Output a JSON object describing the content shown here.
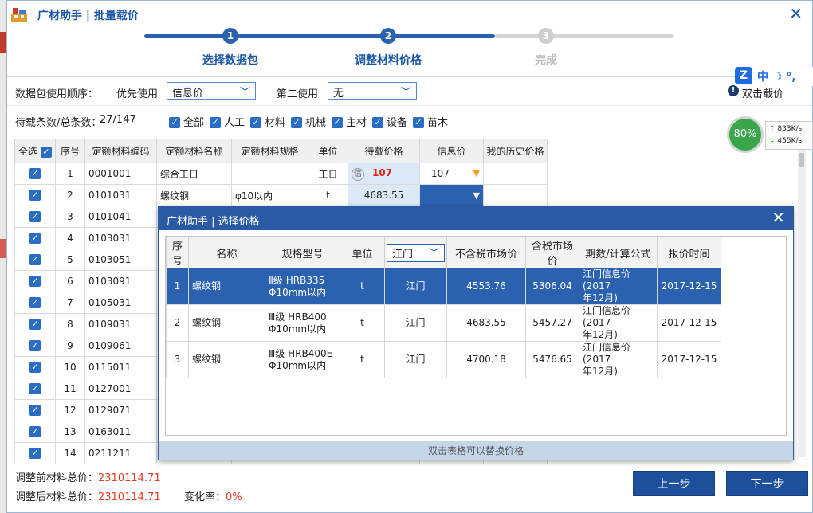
{
  "window": {
    "title": "广材助手 | 批量载价",
    "close": "✕"
  },
  "steps": [
    {
      "num": "1",
      "label": "选择数据包",
      "state": "done"
    },
    {
      "num": "2",
      "label": "调整材料价格",
      "state": "active"
    },
    {
      "num": "3",
      "label": "完成",
      "state": "todo"
    }
  ],
  "toolbar": {
    "order_label": "数据包使用顺序：",
    "first_label": "优先使用",
    "first_value": "信息价",
    "second_label": "第二使用",
    "second_value": "无",
    "info_text": "双击载价"
  },
  "filter": {
    "count_label": "待载条数/总条数：",
    "count_value": "27/147",
    "checks": [
      "全部",
      "人工",
      "材料",
      "机械",
      "主材",
      "设备",
      "苗木"
    ]
  },
  "grid": {
    "headers": [
      "全选",
      "序号",
      "定额材料编码",
      "定额材料名称",
      "定额材料规格",
      "单位",
      "待载价格",
      "信息价",
      "我的历史价格"
    ],
    "rows": [
      {
        "n": "1",
        "code": "0001001",
        "name": "综合工日",
        "spec": "",
        "unit": "工日",
        "price": "107",
        "info": "107"
      },
      {
        "n": "2",
        "code": "0101031",
        "name": "螺纹钢",
        "spec": "φ10以内",
        "unit": "t",
        "price": "4683.55",
        "info": ""
      },
      {
        "n": "3",
        "code": "0101041",
        "name": "",
        "spec": "",
        "unit": "",
        "price": "",
        "info": ""
      },
      {
        "n": "4",
        "code": "0103031",
        "name": "",
        "spec": "",
        "unit": "",
        "price": "",
        "info": ""
      },
      {
        "n": "5",
        "code": "0103051",
        "name": "",
        "spec": "",
        "unit": "",
        "price": "",
        "info": ""
      },
      {
        "n": "6",
        "code": "0103091",
        "name": "",
        "spec": "",
        "unit": "",
        "price": "",
        "info": ""
      },
      {
        "n": "7",
        "code": "0105031",
        "name": "",
        "spec": "",
        "unit": "",
        "price": "",
        "info": ""
      },
      {
        "n": "8",
        "code": "0109031",
        "name": "",
        "spec": "",
        "unit": "",
        "price": "",
        "info": ""
      },
      {
        "n": "9",
        "code": "0109061",
        "name": "",
        "spec": "",
        "unit": "",
        "price": "",
        "info": ""
      },
      {
        "n": "10",
        "code": "0115011",
        "name": "",
        "spec": "",
        "unit": "",
        "price": "",
        "info": ""
      },
      {
        "n": "11",
        "code": "0127001",
        "name": "",
        "spec": "",
        "unit": "",
        "price": "",
        "info": ""
      },
      {
        "n": "12",
        "code": "0129071",
        "name": "",
        "spec": "",
        "unit": "",
        "price": "",
        "info": ""
      },
      {
        "n": "13",
        "code": "0163011",
        "name": "",
        "spec": "",
        "unit": "",
        "price": "",
        "info": ""
      },
      {
        "n": "14",
        "code": "0211211",
        "name": "",
        "spec": "",
        "unit": "",
        "price": "",
        "info": ""
      }
    ],
    "info_badge": "信"
  },
  "summary": {
    "before_label": "调整前材料总价：",
    "before_value": "2310114.71",
    "after_label": "调整后材料总价：",
    "after_value": "2310114.71",
    "rate_label": "变化率：",
    "rate_value": "0%"
  },
  "buttons": {
    "prev": "上一步",
    "next": "下一步"
  },
  "dialog": {
    "title": "广材助手 | 选择价格",
    "close": "✕",
    "headers": [
      "序号",
      "名称",
      "规格型号",
      "单位",
      "江门",
      "不含税市场价",
      "含税市场价",
      "期数/计算公式",
      "报价时间"
    ],
    "rows": [
      {
        "n": "1",
        "name": "螺纹钢",
        "spec1": "Ⅱ级 HRB335",
        "spec2": "Φ10mm以内",
        "unit": "t",
        "city": "江门",
        "ex": "4553.76",
        "inc": "5306.04",
        "period1": "江门信息价(2017",
        "period2": "年12月)",
        "date": "2017-12-15"
      },
      {
        "n": "2",
        "name": "螺纹钢",
        "spec1": "Ⅲ级 HRB400",
        "spec2": "Φ10mm以内",
        "unit": "t",
        "city": "江门",
        "ex": "4683.55",
        "inc": "5457.27",
        "period1": "江门信息价(2017",
        "period2": "年12月)",
        "date": "2017-12-15"
      },
      {
        "n": "3",
        "name": "螺纹钢",
        "spec1": "Ⅲ级 HRB400E",
        "spec2": "Φ10mm以内",
        "unit": "t",
        "city": "江门",
        "ex": "4700.18",
        "inc": "5476.65",
        "period1": "江门信息价(2017",
        "period2": "年12月)",
        "date": "2017-12-15"
      }
    ],
    "footer": "双击表格可以替换价格"
  },
  "overlay": {
    "ime_logo": "Z",
    "ime_text": "中 ☽ °,",
    "net_percent": "80%",
    "up_speed": "833K/s",
    "down_speed": "455K/s"
  },
  "colors": {
    "accent": "#2b62b0",
    "title": "#1a56a3",
    "value_red": "#e03b1e",
    "price_red": "#e0201b"
  }
}
